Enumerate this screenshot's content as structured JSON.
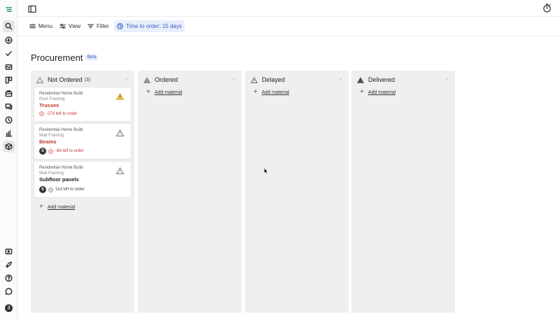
{
  "toolbar": {
    "menu_label": "Menu",
    "view_label": "View",
    "filter_label": "Filter",
    "time_filter_label": "Time to order: 15 days"
  },
  "page": {
    "title": "Procurement",
    "badge": "Beta"
  },
  "rail": {
    "icons": [
      "app-logo-icon",
      "search-icon",
      "add-circle-icon",
      "check-icon",
      "inbox-icon",
      "board-icon",
      "briefcase-icon",
      "chat-icon",
      "clock-icon",
      "chart-icon",
      "package-icon",
      "video-icon",
      "rocket-icon",
      "help-icon",
      "message-icon"
    ],
    "user_initial": "J"
  },
  "columns": [
    {
      "title": "Not Ordered",
      "count": "(3)",
      "add_label": "Add material",
      "cards": [
        {
          "project": "Residential Home Build",
          "phase": "Roof Framing",
          "material": "Trusses",
          "due": "-27d left to order",
          "status": "overdue",
          "assignee": ""
        },
        {
          "project": "Residential Home Build",
          "phase": "Wall Framing",
          "material": "Beams",
          "due": "-6d left to order",
          "status": "overdue",
          "assignee": "S"
        },
        {
          "project": "Residential Home Build",
          "phase": "Wall Framing",
          "material": "Subfloor panels",
          "due": "11d left to order",
          "status": "ok",
          "assignee": "S"
        }
      ]
    },
    {
      "title": "Ordered",
      "count": "",
      "add_label": "Add material",
      "cards": []
    },
    {
      "title": "Delayed",
      "count": "",
      "add_label": "Add material",
      "cards": []
    },
    {
      "title": "Delivered",
      "count": "",
      "add_label": "Add material",
      "cards": []
    }
  ],
  "colors": {
    "accent": "#3d62c4",
    "danger": "#c0392b",
    "warning": "#f2c94c",
    "column_bg": "#efeff0"
  }
}
